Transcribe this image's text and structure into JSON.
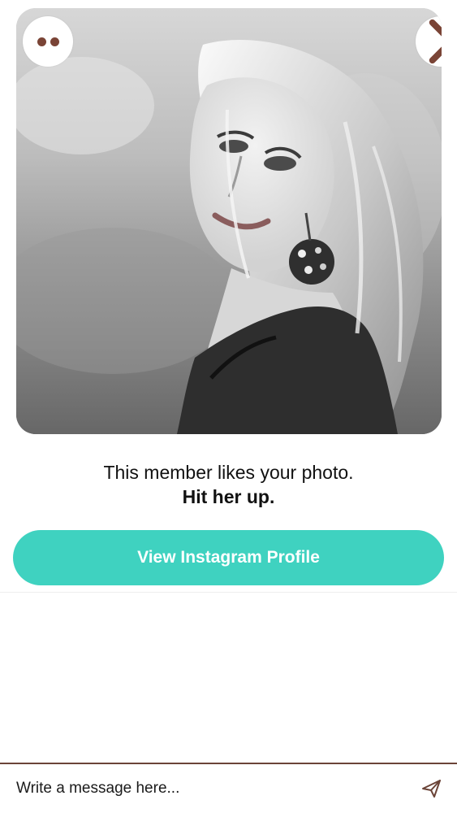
{
  "profile_card": {
    "photo_icon": "person-photo-icon"
  },
  "header_controls": {
    "menu_icon": "dots-icon",
    "next_icon": "chevron-right-icon",
    "accent_color": "#7a4436"
  },
  "message": {
    "line1": "This member likes your photo.",
    "line2": "Hit her up."
  },
  "cta": {
    "label": "View Instagram Profile",
    "color": "#3fd2c0"
  },
  "composer": {
    "placeholder": "Write a message here...",
    "send_icon": "send-icon",
    "border_color": "#6b4438"
  }
}
